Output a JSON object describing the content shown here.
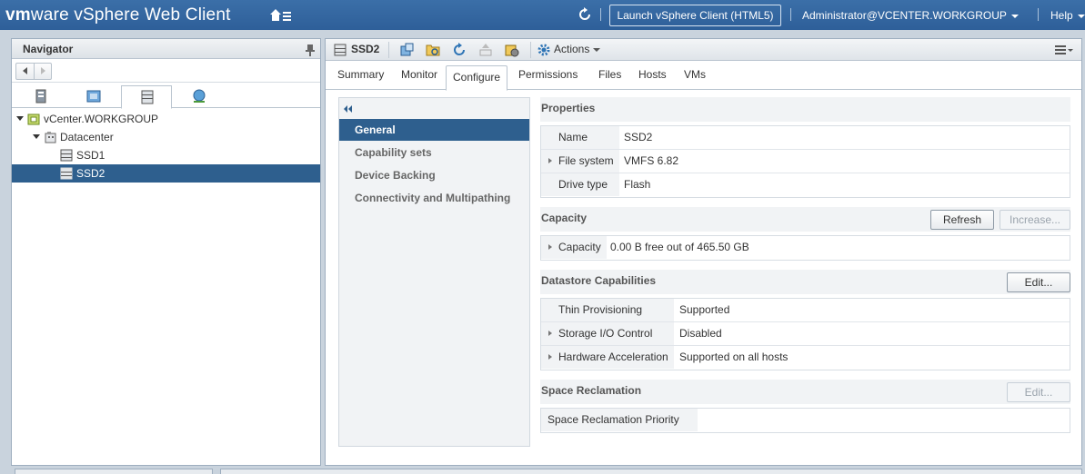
{
  "header": {
    "brand_vm": "vm",
    "brand_ware": "ware",
    "brand_product": " vSphere Web Client",
    "launch_html5_label": "Launch vSphere Client (HTML5)",
    "user_label": "Administrator@VCENTER.WORKGROUP",
    "help_label": "Help"
  },
  "navigator": {
    "title": "Navigator",
    "tree": [
      {
        "label": "vCenter.WORKGROUP",
        "icon": "vcenter-icon"
      },
      {
        "label": "Datacenter",
        "icon": "datacenter-icon"
      },
      {
        "label": "SSD1",
        "icon": "datastore-icon"
      },
      {
        "label": "SSD2",
        "icon": "datastore-icon",
        "selected": true
      }
    ]
  },
  "object": {
    "title": "SSD2",
    "actions_label": "Actions"
  },
  "tabs": [
    "Summary",
    "Monitor",
    "Configure",
    "Permissions",
    "Files",
    "Hosts",
    "VMs"
  ],
  "active_tab": "Configure",
  "configure_menu": {
    "items": [
      "General",
      "Capability sets",
      "Device Backing",
      "Connectivity and Multipathing"
    ],
    "active": "General"
  },
  "properties": {
    "title": "Properties",
    "rows": [
      {
        "key": "Name",
        "value": "SSD2"
      },
      {
        "key": "File system",
        "value": "VMFS 6.82"
      },
      {
        "key": "Drive type",
        "value": "Flash"
      }
    ]
  },
  "capacity": {
    "title": "Capacity",
    "refresh_label": "Refresh",
    "increase_label": "Increase...",
    "row_key": "Capacity",
    "row_value": "0.00 B free out of 465.50 GB"
  },
  "datastore_capabilities": {
    "title": "Datastore Capabilities",
    "edit_label": "Edit...",
    "rows": [
      {
        "key": "Thin Provisioning",
        "value": "Supported"
      },
      {
        "key": "Storage I/O Control",
        "value": "Disabled"
      },
      {
        "key": "Hardware Acceleration",
        "value": "Supported on all hosts"
      }
    ]
  },
  "space_reclamation": {
    "title": "Space Reclamation",
    "edit_label": "Edit...",
    "row_key": "Space Reclamation Priority",
    "row_value": ""
  },
  "colors": {
    "header_blue": "#2e5f99",
    "selection_blue": "#2e5f8e"
  }
}
